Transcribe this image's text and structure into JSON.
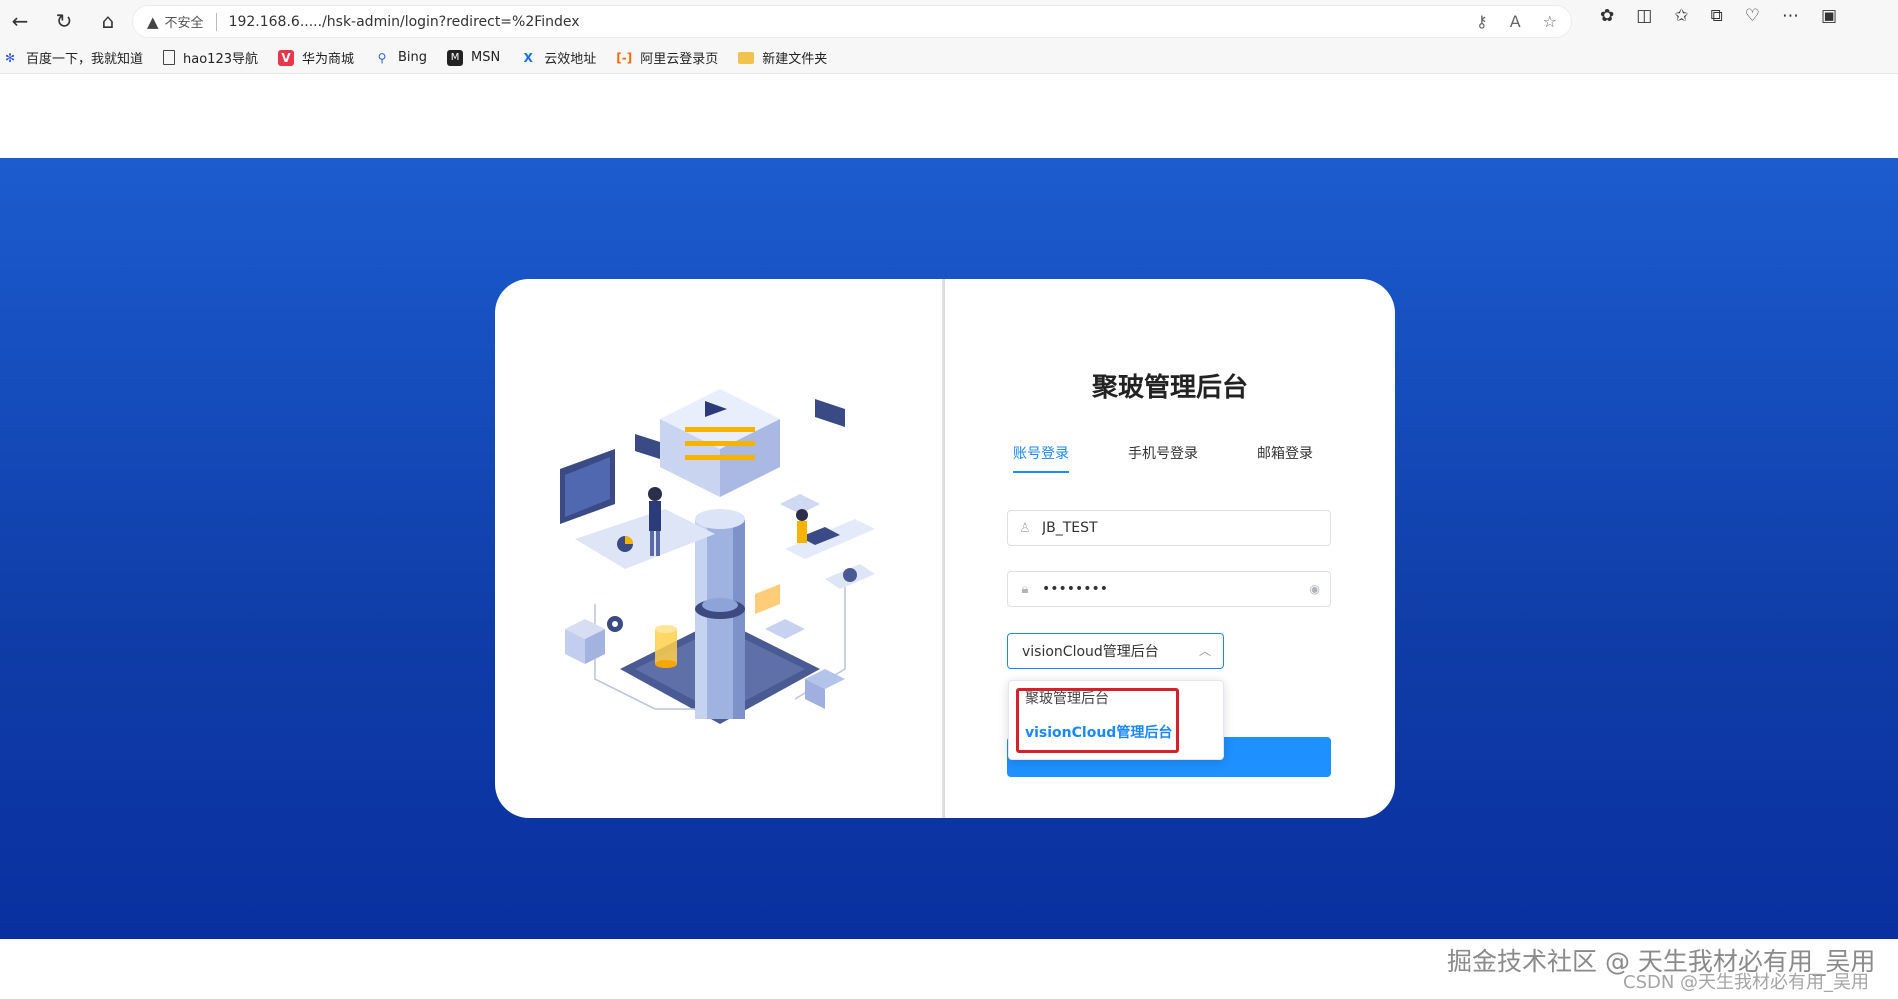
{
  "browser": {
    "insecure_label": "不安全",
    "url": "192.168.6...../hsk-admin/login?redirect=%2Findex",
    "bookmarks": [
      {
        "label": "百度一下，我就知道",
        "icon": "baidu-paw-icon"
      },
      {
        "label": "hao123导航",
        "icon": "page-icon"
      },
      {
        "label": "华为商城",
        "icon": "vmall-icon"
      },
      {
        "label": "Bing",
        "icon": "search-icon"
      },
      {
        "label": "MSN",
        "icon": "msn-icon"
      },
      {
        "label": "云效地址",
        "icon": "yunxiao-icon"
      },
      {
        "label": "阿里云登录页",
        "icon": "aliyun-icon"
      },
      {
        "label": "新建文件夹",
        "icon": "folder-icon"
      }
    ]
  },
  "login": {
    "title": "聚玻管理后台",
    "tabs": [
      {
        "label": "账号登录",
        "active": true
      },
      {
        "label": "手机号登录",
        "active": false
      },
      {
        "label": "邮箱登录",
        "active": false
      }
    ],
    "username": "JB_TEST",
    "password": "••••••••",
    "system_select": "visionCloud管理后台",
    "options": [
      {
        "label": "聚玻管理后台",
        "selected": false
      },
      {
        "label": "visionCloud管理后台",
        "selected": true
      }
    ]
  },
  "colors": {
    "accent": "#1b88ff",
    "banner": "#1c5ccf",
    "highlight": "#d6212d"
  },
  "watermark": {
    "line1": "掘金技术社区 @ 天生我材必有用_吴用",
    "line2": "CSDN @天生我材必有用_吴用"
  }
}
